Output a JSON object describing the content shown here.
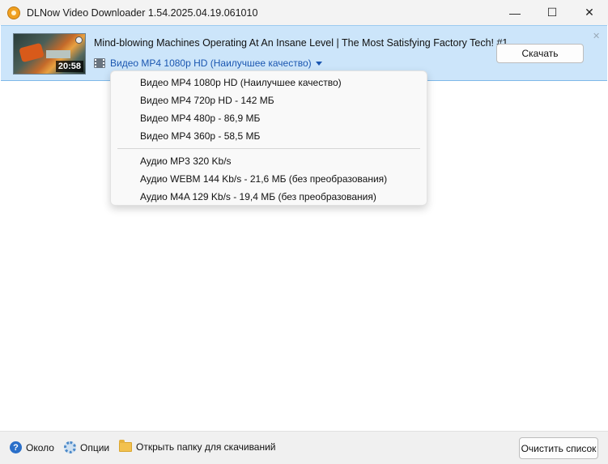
{
  "window": {
    "title": "DLNow Video Downloader 1.54.2025.04.19.061010",
    "app_icon": "headphones-icon",
    "controls": {
      "minimize": "—",
      "maximize": "☐",
      "close": "✕"
    }
  },
  "item": {
    "title": "Mind-blowing Machines Operating At An Insane Level | The Most Satisfying Factory Tech! #1",
    "duration": "20:58",
    "selected_format": "Видео MP4 1080p HD (Наилучшее качество)",
    "download_label": "Скачать",
    "close_symbol": "✕"
  },
  "format_menu": {
    "video": [
      "Видео MP4 1080p HD (Наилучшее качество)",
      "Видео MP4 720p HD - 142 МБ",
      "Видео MP4 480p - 86,9 МБ",
      "Видео MP4 360p - 58,5 МБ"
    ],
    "audio": [
      "Аудио MP3 320 Kb/s",
      "Аудио WEBM 144 Kb/s - 21,6 МБ (без преобразования)",
      "Аудио M4A 129 Kb/s - 19,4 МБ (без преобразования)"
    ]
  },
  "bottom": {
    "about": "Около",
    "options": "Опции",
    "open_folder": "Открыть папку для скачиваний",
    "clear_list": "Очистить список",
    "help_glyph": "?"
  }
}
